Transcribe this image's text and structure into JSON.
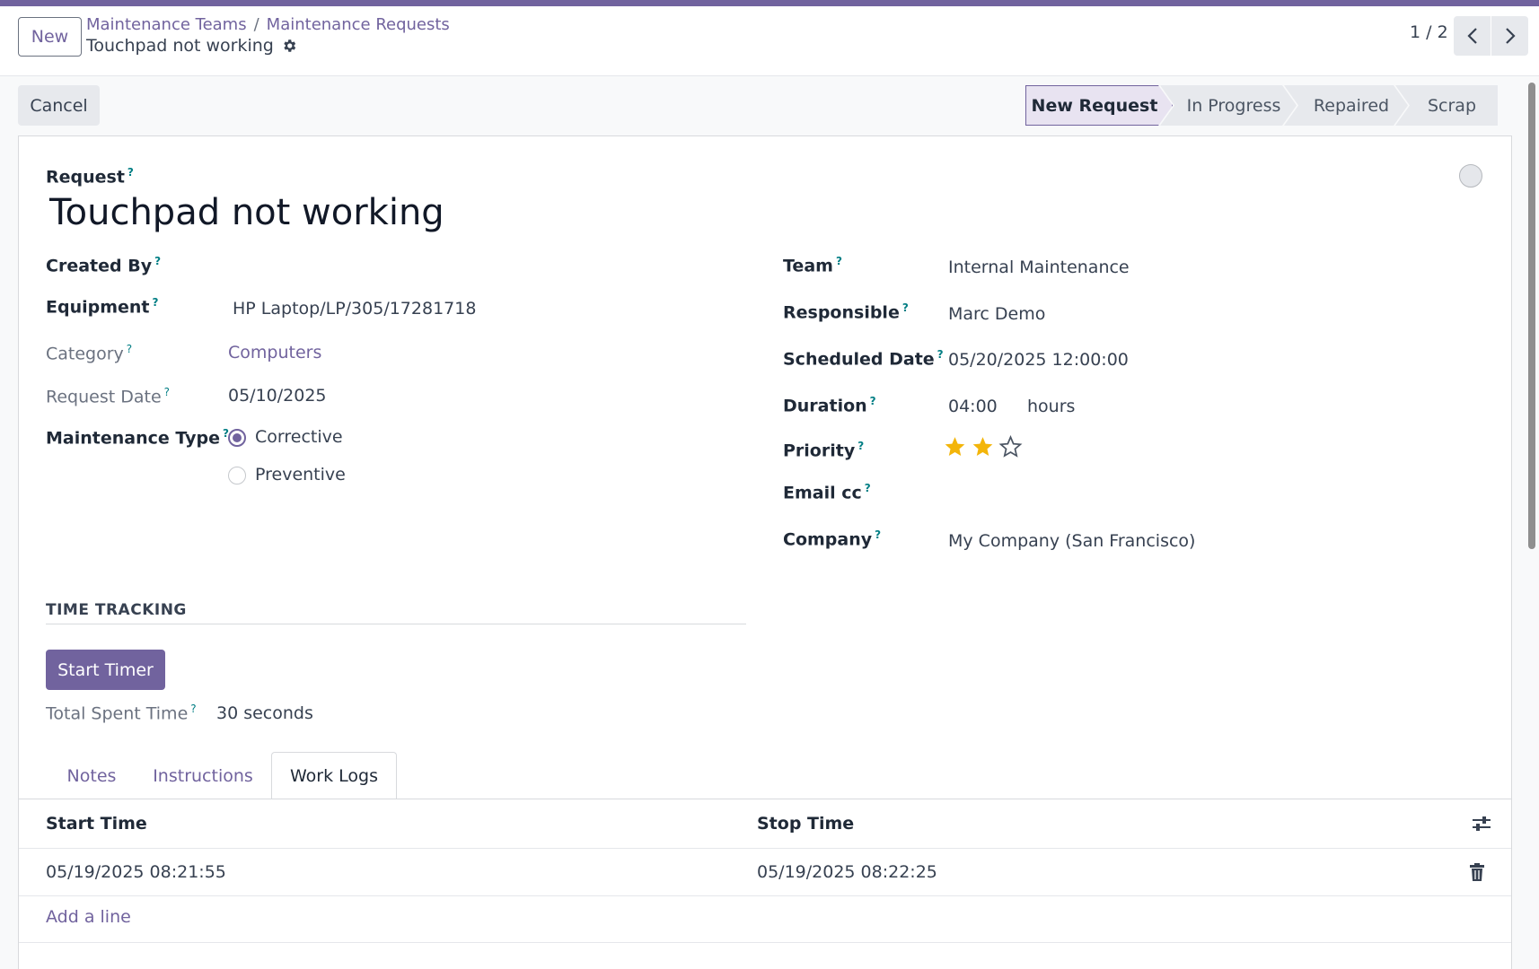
{
  "breadcrumb": {
    "new_label": "New",
    "items": [
      "Maintenance Teams",
      "Maintenance Requests"
    ],
    "current": "Touchpad not working"
  },
  "pager": {
    "value": "1 / 2"
  },
  "actions": {
    "cancel_label": "Cancel"
  },
  "stages": [
    "New Request",
    "In Progress",
    "Repaired",
    "Scrap"
  ],
  "active_stage": "New Request",
  "form": {
    "request_label": "Request",
    "title": "Touchpad not working",
    "left": {
      "created_by": {
        "label": "Created By",
        "value": ""
      },
      "equipment": {
        "label": "Equipment",
        "value": "HP Laptop/LP/305/17281718"
      },
      "category": {
        "label": "Category",
        "value": "Computers"
      },
      "request_date": {
        "label": "Request Date",
        "value": "05/10/2025"
      },
      "maintenance_type": {
        "label": "Maintenance Type",
        "options": [
          "Corrective",
          "Preventive"
        ],
        "selected": "Corrective"
      }
    },
    "right": {
      "team": {
        "label": "Team",
        "value": "Internal Maintenance"
      },
      "responsible": {
        "label": "Responsible",
        "value": "Marc Demo"
      },
      "scheduled_date": {
        "label": "Scheduled Date",
        "value": "05/20/2025 12:00:00"
      },
      "duration": {
        "label": "Duration",
        "value": "04:00",
        "unit": "hours"
      },
      "priority": {
        "label": "Priority",
        "stars": 2,
        "max": 3
      },
      "email_cc": {
        "label": "Email cc",
        "value": ""
      },
      "company": {
        "label": "Company",
        "value": "My Company (San Francisco)"
      }
    },
    "question_mark": "?"
  },
  "time_tracking": {
    "title": "TIME TRACKING",
    "start_timer_label": "Start Timer",
    "total_label": "Total Spent Time",
    "total_value": "30 seconds"
  },
  "tabs": [
    "Notes",
    "Instructions",
    "Work Logs"
  ],
  "active_tab": "Work Logs",
  "work_logs": {
    "columns": [
      "Start Time",
      "Stop Time"
    ],
    "rows": [
      {
        "start": "05/19/2025 08:21:55",
        "stop": "05/19/2025 08:22:25"
      }
    ],
    "add_line_label": "Add a line"
  },
  "colors": {
    "brand": "#71639e",
    "help": "#017e84",
    "star": "#f3b50a"
  }
}
